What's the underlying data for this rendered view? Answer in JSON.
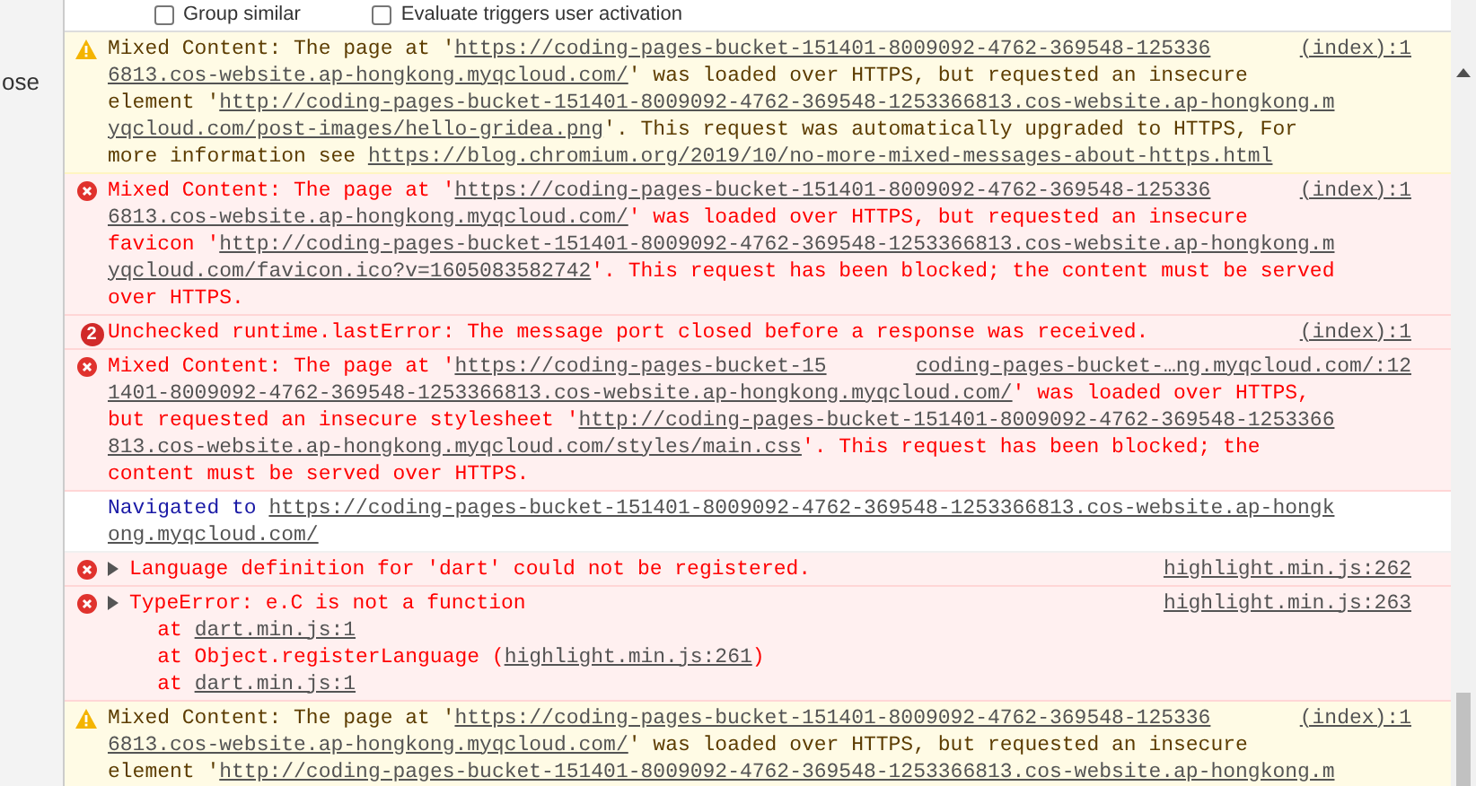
{
  "side_panel": {
    "label": "ose"
  },
  "toolbar": {
    "options": [
      {
        "label": "Group similar",
        "checked": false
      },
      {
        "label": "Evaluate triggers user activation",
        "checked": false
      }
    ]
  },
  "messages": [
    {
      "kind": "warning",
      "expandable": false,
      "source": "(index):1",
      "lines": [
        [
          {
            "kind": "text",
            "text": "Mixed Content: The page at '"
          },
          {
            "kind": "link",
            "text": "https://coding-pages-bucket-151401-8009092-4762-369548-125336"
          }
        ],
        [
          {
            "kind": "link",
            "text": "6813.cos-website.ap-hongkong.myqcloud.com/"
          },
          {
            "kind": "text",
            "text": "' was loaded over HTTPS, but requested an insecure"
          }
        ],
        [
          {
            "kind": "text",
            "text": "element '"
          },
          {
            "kind": "link",
            "text": "http://coding-pages-bucket-151401-8009092-4762-369548-1253366813.cos-website.ap-hongkong.m"
          }
        ],
        [
          {
            "kind": "link",
            "text": "yqcloud.com/post-images/hello-gridea.png"
          },
          {
            "kind": "text",
            "text": "'. This request was automatically upgraded to HTTPS, For"
          }
        ],
        [
          {
            "kind": "text",
            "text": "more information see "
          },
          {
            "kind": "link",
            "text": "https://blog.chromium.org/2019/10/no-more-mixed-messages-about-https.html"
          }
        ]
      ]
    },
    {
      "kind": "error",
      "expandable": false,
      "source": "(index):1",
      "lines": [
        [
          {
            "kind": "text",
            "text": "Mixed Content: The page at '"
          },
          {
            "kind": "link",
            "text": "https://coding-pages-bucket-151401-8009092-4762-369548-125336"
          }
        ],
        [
          {
            "kind": "link",
            "text": "6813.cos-website.ap-hongkong.myqcloud.com/"
          },
          {
            "kind": "text",
            "text": "' was loaded over HTTPS, but requested an insecure"
          }
        ],
        [
          {
            "kind": "text",
            "text": "favicon '"
          },
          {
            "kind": "link",
            "text": "http://coding-pages-bucket-151401-8009092-4762-369548-1253366813.cos-website.ap-hongkong.m"
          }
        ],
        [
          {
            "kind": "link",
            "text": "yqcloud.com/favicon.ico?v=1605083582742"
          },
          {
            "kind": "text",
            "text": "'. This request has been blocked; the content must be served"
          }
        ],
        [
          {
            "kind": "text",
            "text": "over HTTPS."
          }
        ]
      ]
    },
    {
      "kind": "error",
      "count": "2",
      "expandable": false,
      "source": "(index):1",
      "lines": [
        [
          {
            "kind": "text",
            "text": "Unchecked runtime.lastError: The message port closed before a response was received."
          }
        ]
      ]
    },
    {
      "kind": "error",
      "expandable": false,
      "source": "coding-pages-bucket-…ng.myqcloud.com/:12",
      "lines": [
        [
          {
            "kind": "text",
            "text": "Mixed Content: The page at '"
          },
          {
            "kind": "link",
            "text": "https://coding-pages-bucket-15"
          }
        ],
        [
          {
            "kind": "link",
            "text": "1401-8009092-4762-369548-1253366813.cos-website.ap-hongkong.myqcloud.com/"
          },
          {
            "kind": "text",
            "text": "' was loaded over HTTPS,"
          }
        ],
        [
          {
            "kind": "text",
            "text": "but requested an insecure stylesheet '"
          },
          {
            "kind": "link",
            "text": "http://coding-pages-bucket-151401-8009092-4762-369548-1253366"
          }
        ],
        [
          {
            "kind": "link",
            "text": "813.cos-website.ap-hongkong.myqcloud.com/styles/main.css"
          },
          {
            "kind": "text",
            "text": "'. This request has been blocked; the"
          }
        ],
        [
          {
            "kind": "text",
            "text": "content must be served over HTTPS."
          }
        ]
      ]
    },
    {
      "kind": "info",
      "expandable": false,
      "lines": [
        [
          {
            "kind": "text",
            "text": "Navigated to "
          },
          {
            "kind": "link",
            "text": "https://coding-pages-bucket-151401-8009092-4762-369548-1253366813.cos-website.ap-hongk"
          }
        ],
        [
          {
            "kind": "link",
            "text": "ong.myqcloud.com/"
          }
        ]
      ]
    },
    {
      "kind": "error",
      "expandable": true,
      "source": "highlight.min.js:262",
      "lines": [
        [
          {
            "kind": "text",
            "text": "Language definition for 'dart' could not be registered."
          }
        ]
      ]
    },
    {
      "kind": "error",
      "expandable": true,
      "source": "highlight.min.js:263",
      "lines": [
        [
          {
            "kind": "text",
            "text": "TypeError: e.C is not a function"
          }
        ],
        [
          {
            "kind": "text",
            "text": "    at "
          },
          {
            "kind": "link",
            "text": "dart.min.js:1"
          }
        ],
        [
          {
            "kind": "text",
            "text": "    at Object.registerLanguage ("
          },
          {
            "kind": "link",
            "text": "highlight.min.js:261"
          },
          {
            "kind": "text",
            "text": ")"
          }
        ],
        [
          {
            "kind": "text",
            "text": "    at "
          },
          {
            "kind": "link",
            "text": "dart.min.js:1"
          }
        ]
      ]
    },
    {
      "kind": "warning",
      "expandable": false,
      "source": "(index):1",
      "lines": [
        [
          {
            "kind": "text",
            "text": "Mixed Content: The page at '"
          },
          {
            "kind": "link",
            "text": "https://coding-pages-bucket-151401-8009092-4762-369548-125336"
          }
        ],
        [
          {
            "kind": "link",
            "text": "6813.cos-website.ap-hongkong.myqcloud.com/"
          },
          {
            "kind": "text",
            "text": "' was loaded over HTTPS, but requested an insecure"
          }
        ],
        [
          {
            "kind": "text",
            "text": "element '"
          },
          {
            "kind": "link",
            "text": "http://coding-pages-bucket-151401-8009092-4762-369548-1253366813.cos-website.ap-hongkong.m"
          }
        ]
      ]
    }
  ]
}
